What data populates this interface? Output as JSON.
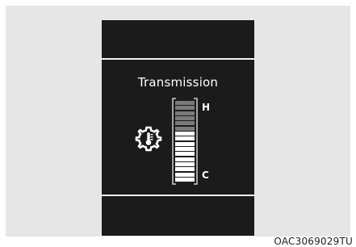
{
  "display": {
    "title": "Transmission",
    "hot_label": "H",
    "cold_label": "C",
    "icon": "transmission-temperature-icon",
    "level": 0.6,
    "segments": 16
  },
  "colors": {
    "background": "#e6e6e6",
    "screen": "#1b1b1b",
    "lit_segment": "#ffffff",
    "unlit_segment": "#7a7a7a"
  },
  "caption": "OAC3069029TU"
}
